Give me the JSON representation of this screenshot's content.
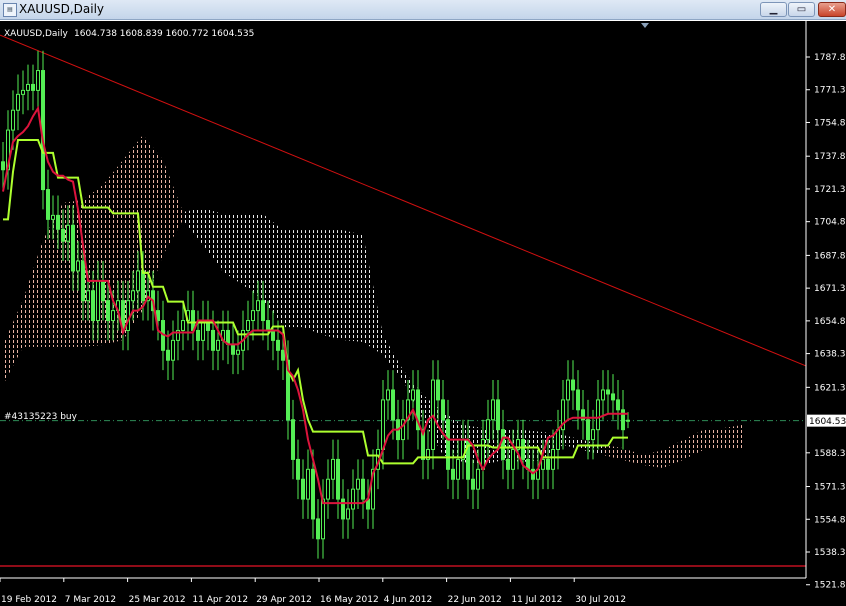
{
  "window": {
    "title": "XAUUSD,Daily",
    "icon": "chart-window-icon",
    "buttons": {
      "minimize": "minimize-icon",
      "maximize": "maximize-icon",
      "close": "close-icon"
    }
  },
  "chart_info": {
    "symbol_timeframe": "XAUUSD,Daily",
    "ohlc": "1604.738 1608.839 1600.772 1604.535"
  },
  "order_label": "#43135223 buy",
  "current_price_label": "1604.53",
  "colors": {
    "background": "#000000",
    "candles": "#55ee55",
    "tenkan": "#dc143c",
    "kijun": "#adff2f",
    "trendline": "#d01010",
    "support": "#c01020",
    "order_line": "#2e8b57",
    "cloud_bear": "#e8b4a4",
    "cloud_bull": "#e8e8e8"
  },
  "chart_data": {
    "type": "candlestick",
    "symbol": "XAUUSD",
    "timeframe": "Daily",
    "last_bar": {
      "open": 1604.738,
      "high": 1608.839,
      "low": 1600.772,
      "close": 1604.535
    },
    "ylim": [
      1521.83,
      1795
    ],
    "y_ticks": [
      "1787.83",
      "1771.33",
      "1754.83",
      "1737.83",
      "1721.33",
      "1704.83",
      "1687.83",
      "1671.33",
      "1654.83",
      "1638.33",
      "1621.33",
      "1588.33",
      "1571.33",
      "1554.83",
      "1538.33",
      "1521.83"
    ],
    "x_ticks": [
      "19 Feb 2012",
      "7 Mar 2012",
      "25 Mar 2012",
      "11 Apr 2012",
      "29 Apr 2012",
      "16 May 2012",
      "4 Jun 2012",
      "22 Jun 2012",
      "11 Jul 2012",
      "30 Jul 2012"
    ],
    "close": [
      1731,
      1751,
      1761,
      1769,
      1771,
      1774,
      1771,
      1781,
      1721,
      1706,
      1708,
      1701,
      1695,
      1703,
      1680,
      1685,
      1665,
      1670,
      1655,
      1675,
      1665,
      1655,
      1660,
      1665,
      1650,
      1665,
      1670,
      1680,
      1665,
      1670,
      1660,
      1655,
      1640,
      1635,
      1645,
      1650,
      1655,
      1660,
      1650,
      1645,
      1655,
      1650,
      1640,
      1645,
      1650,
      1643,
      1638,
      1640,
      1650,
      1655,
      1660,
      1665,
      1655,
      1650,
      1645,
      1640,
      1635,
      1605,
      1585,
      1575,
      1565,
      1580,
      1555,
      1545,
      1565,
      1575,
      1585,
      1565,
      1555,
      1560,
      1570,
      1575,
      1565,
      1560,
      1580,
      1590,
      1615,
      1620,
      1605,
      1595,
      1605,
      1615,
      1620,
      1600,
      1585,
      1590,
      1625,
      1615,
      1605,
      1580,
      1575,
      1585,
      1595,
      1575,
      1570,
      1580,
      1595,
      1605,
      1615,
      1600,
      1585,
      1580,
      1590,
      1595,
      1585,
      1580,
      1575,
      1580,
      1585,
      1580,
      1590,
      1600,
      1615,
      1625,
      1620,
      1610,
      1605,
      1595,
      1600,
      1615,
      1620,
      1618,
      1615,
      1610,
      1600,
      1604.535
    ],
    "tenkan_sen": [
      1720,
      1733,
      1745,
      1748,
      1750,
      1753,
      1758,
      1762,
      1745,
      1735,
      1730,
      1728,
      1728,
      1726,
      1725,
      1711,
      1693,
      1675,
      1675,
      1675,
      1675,
      1675,
      1665,
      1660,
      1649,
      1655,
      1660,
      1660,
      1662,
      1667,
      1665,
      1650,
      1648,
      1647,
      1649,
      1649,
      1649,
      1649,
      1649,
      1655,
      1655,
      1655,
      1655,
      1650,
      1645,
      1643,
      1643,
      1643,
      1645,
      1648,
      1650,
      1650,
      1650,
      1650,
      1650,
      1650,
      1648,
      1630,
      1627,
      1620,
      1610,
      1595,
      1585,
      1575,
      1563,
      1563,
      1563,
      1563,
      1563,
      1563,
      1563,
      1563,
      1563,
      1565,
      1578,
      1583,
      1590,
      1597,
      1600,
      1600,
      1602,
      1606,
      1610,
      1604,
      1598,
      1605,
      1607,
      1602,
      1598,
      1595,
      1595,
      1595,
      1595,
      1595,
      1592,
      1585,
      1580,
      1585,
      1588,
      1590,
      1596,
      1596,
      1592,
      1588,
      1582,
      1580,
      1578,
      1580,
      1588,
      1596,
      1597,
      1600,
      1603,
      1605,
      1606,
      1606,
      1606,
      1606,
      1606,
      1606,
      1607,
      1608,
      1608,
      1608,
      1608,
      1608
    ],
    "kijun_sen": [
      1706,
      1706,
      1730,
      1746,
      1746,
      1746,
      1746,
      1746,
      1739.5,
      1739.5,
      1739.5,
      1727,
      1727,
      1727,
      1727,
      1727,
      1712,
      1712,
      1712,
      1712,
      1712,
      1712,
      1709,
      1709,
      1709,
      1709,
      1709,
      1709,
      1679,
      1679,
      1672,
      1672,
      1672,
      1664.5,
      1664.5,
      1664.5,
      1664.5,
      1654,
      1654,
      1654,
      1654,
      1654,
      1654,
      1654,
      1654,
      1654,
      1654,
      1648,
      1648,
      1648,
      1648,
      1648,
      1648,
      1648,
      1652,
      1652,
      1652,
      1630,
      1625,
      1630,
      1615,
      1605,
      1599,
      1599,
      1599,
      1599,
      1599,
      1599,
      1599,
      1599,
      1599,
      1599,
      1599,
      1587,
      1587,
      1587,
      1583,
      1583,
      1583,
      1583,
      1583,
      1583,
      1583,
      1586,
      1586,
      1586,
      1586,
      1586,
      1586,
      1586,
      1586,
      1586,
      1586,
      1592,
      1592,
      1592,
      1592,
      1592,
      1591,
      1591,
      1591,
      1591,
      1591,
      1591,
      1591,
      1591,
      1591,
      1591,
      1586,
      1586,
      1586,
      1586,
      1586,
      1586,
      1586,
      1592,
      1592,
      1592,
      1592,
      1592,
      1592,
      1592,
      1596,
      1596,
      1596,
      1596
    ],
    "cloud_upper": [
      1642.7,
      1665.4,
      1695.6,
      1714.3,
      1715.8,
      1723.3,
      1735.9,
      1748.5,
      1735.9,
      1709.7,
      1711.7,
      1708.7,
      1708.7,
      1708.7,
      1700.6,
      1700.6,
      1700.6,
      1700.6,
      1698.1,
      1647.7,
      1630.1,
      1617.5,
      1608.9,
      1602.4,
      1600.8,
      1600.8,
      1599.8,
      1598.8,
      1597.3,
      1594.8,
      1592.3,
      1590.7,
      1587.2,
      1589.7,
      1594.8,
      1599.8,
      1600.8,
      1602.4
    ],
    "cloud_lower": [
      1622.5,
      1641.7,
      1641.7,
      1641.7,
      1641.7,
      1642.7,
      1645.2,
      1660.3,
      1688.0,
      1705.7,
      1693.1,
      1679.5,
      1672.9,
      1665.4,
      1651.7,
      1651.7,
      1647.7,
      1645.2,
      1644.2,
      1637.6,
      1625.0,
      1604.9,
      1587.2,
      1583.7,
      1582.2,
      1584.7,
      1583.7,
      1584.7,
      1592.3,
      1589.7,
      1587.2,
      1584.7,
      1582.2,
      1580.7,
      1584.7,
      1589.7,
      1590.7,
      1590.7
    ],
    "trendline": {
      "start_price": 1798.9,
      "end_price": 1632.1
    },
    "support_line": {
      "price": 1531.3
    },
    "order_line": {
      "price": 1604.535
    },
    "bid_line": {
      "price": 1604.535
    }
  }
}
